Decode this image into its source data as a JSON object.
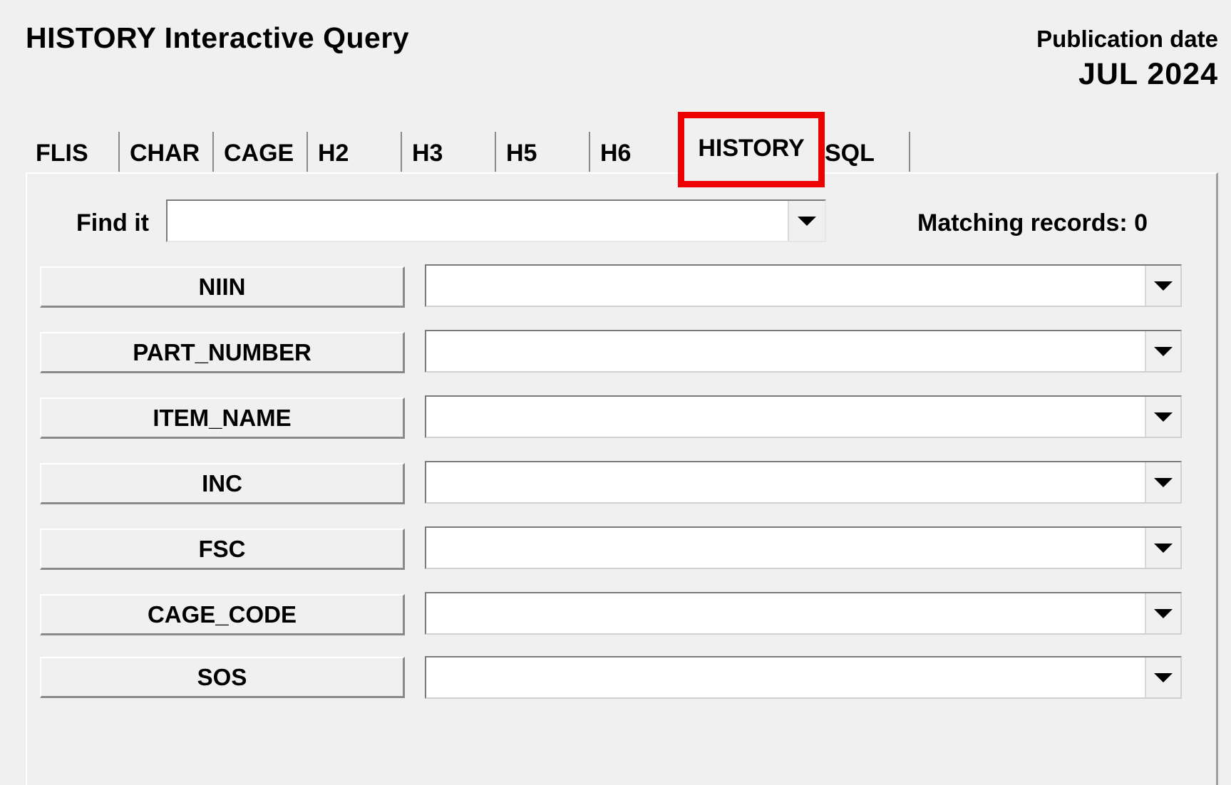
{
  "header": {
    "title": "HISTORY Interactive Query",
    "publication_label": "Publication date",
    "publication_value": "JUL 2024"
  },
  "tabs": [
    {
      "label": "FLIS"
    },
    {
      "label": "CHAR"
    },
    {
      "label": "CAGE"
    },
    {
      "label": "H2"
    },
    {
      "label": "H3"
    },
    {
      "label": "H5"
    },
    {
      "label": "H6"
    },
    {
      "label": "HISTORY",
      "active": true
    },
    {
      "label": "SQL"
    }
  ],
  "find": {
    "label": "Find it",
    "value": "",
    "matching_label": "Matching records: 0"
  },
  "fields": [
    {
      "label": "NIIN",
      "value": ""
    },
    {
      "label": "PART_NUMBER",
      "value": ""
    },
    {
      "label": "ITEM_NAME",
      "value": ""
    },
    {
      "label": "INC",
      "value": ""
    },
    {
      "label": "FSC",
      "value": ""
    },
    {
      "label": "CAGE_CODE",
      "value": ""
    },
    {
      "label": "SOS",
      "value": ""
    }
  ],
  "colors": {
    "background": "#f0f0f0",
    "highlight": "#ee0000"
  },
  "icons": [
    "chevron-down-icon"
  ]
}
